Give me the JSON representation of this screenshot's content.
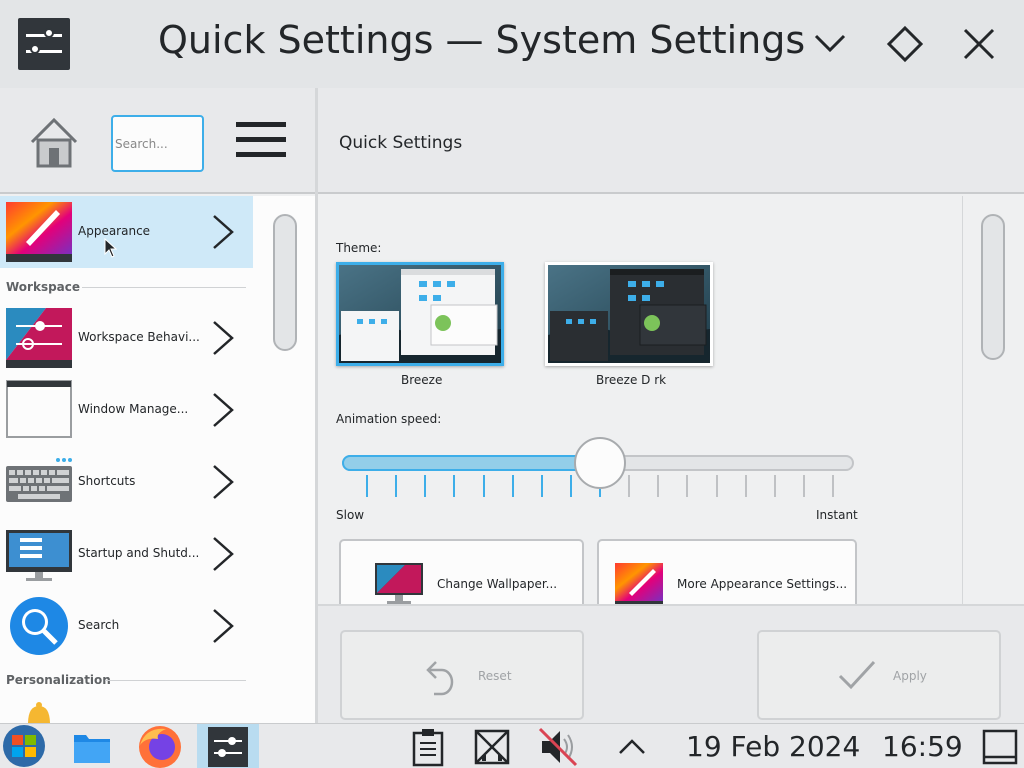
{
  "window": {
    "title": "Quick Settings — System Settings"
  },
  "toolbar": {
    "search_placeholder": "Search...",
    "page_title": "Quick Settings"
  },
  "sidebar": {
    "items": [
      {
        "label": "Appearance",
        "icon": "appearance-icon",
        "active": true
      },
      {
        "label": "Workspace Behavi...",
        "icon": "workspace-behavior-icon"
      },
      {
        "label": "Window Manage...",
        "icon": "window-management-icon"
      },
      {
        "label": "Shortcuts",
        "icon": "keyboard-icon"
      },
      {
        "label": "Startup and Shutd...",
        "icon": "monitor-icon"
      },
      {
        "label": "Search",
        "icon": "search-icon"
      }
    ],
    "sections": {
      "workspace": "Workspace",
      "personalization": "Personalization"
    }
  },
  "main": {
    "theme_label": "Theme:",
    "themes": [
      {
        "name": "Breeze",
        "selected": true
      },
      {
        "name": "Breeze D  rk",
        "selected": false
      }
    ],
    "animation_label": "Animation speed:",
    "animation_value_fraction": 0.5,
    "slider_min_label": "Slow",
    "slider_max_label": "Instant",
    "buttons": {
      "wallpaper": "Change Wallpaper...",
      "more_appearance": "More Appearance Settings..."
    }
  },
  "footer": {
    "reset": "Reset",
    "apply": "Apply"
  },
  "taskbar": {
    "date": "19 Feb 2024",
    "time": "16:59"
  },
  "colors": {
    "accent": "#3daee9",
    "selection": "#cfe9f8"
  }
}
